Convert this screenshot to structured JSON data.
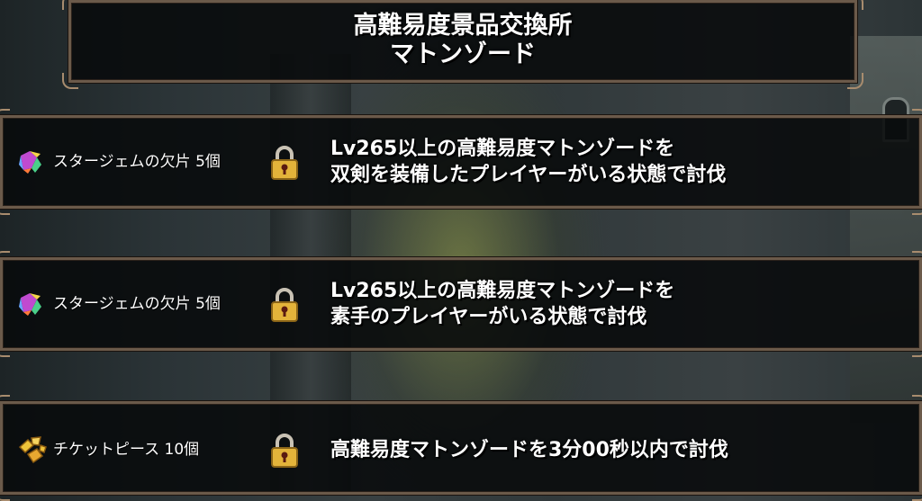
{
  "header": {
    "title_line1": "高難易度景品交換所",
    "title_line2": "マトンゾード"
  },
  "rewards": [
    {
      "icon": "star-gem-fragment-icon",
      "label": "スタージェムの欠片 5個",
      "locked": true,
      "condition_line1": "Lv265以上の高難易度マトンゾードを",
      "condition_line2": "双剣を装備したプレイヤーがいる状態で討伐"
    },
    {
      "icon": "star-gem-fragment-icon",
      "label": "スタージェムの欠片 5個",
      "locked": true,
      "condition_line1": "Lv265以上の高難易度マトンゾードを",
      "condition_line2": "素手のプレイヤーがいる状態で討伐"
    },
    {
      "icon": "ticket-piece-icon",
      "label": "チケットピース 10個",
      "locked": true,
      "condition_line1": "高難易度マトンゾードを3分00秒以内で討伐",
      "condition_line2": ""
    }
  ],
  "colors": {
    "frame_border": "#6b5a4a",
    "frame_corner": "#a88c6e",
    "lock_gold": "#e3b33a",
    "text": "#ffffff"
  }
}
